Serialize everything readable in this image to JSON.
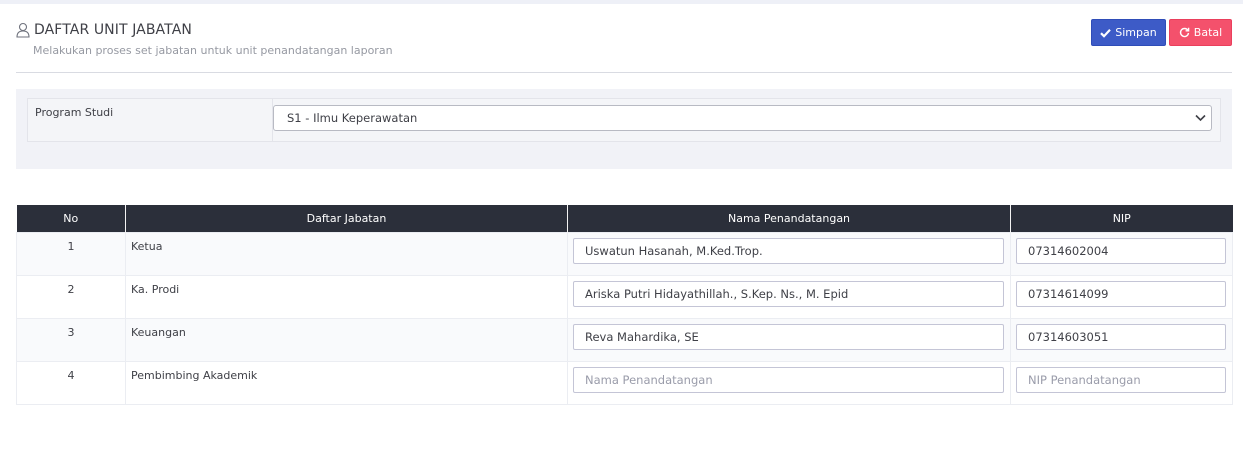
{
  "header": {
    "title": "DAFTAR UNIT JABATAN",
    "subtitle": "Melakukan proses set jabatan untuk unit penandatangan laporan",
    "icon": "user-icon"
  },
  "actions": {
    "save_label": "Simpan",
    "cancel_label": "Batal",
    "save_color": "#3d5bc7",
    "cancel_color": "#f4516c"
  },
  "filter": {
    "label": "Program Studi",
    "selected": "S1 - Ilmu Keperawatan"
  },
  "table": {
    "columns": [
      "No",
      "Daftar Jabatan",
      "Nama Penandatangan",
      "NIP"
    ],
    "rows": [
      {
        "no": "1",
        "jabatan": "Ketua",
        "nama": "Uswatun Hasanah, M.Ked.Trop.",
        "nip": "07314602004"
      },
      {
        "no": "2",
        "jabatan": "Ka. Prodi",
        "nama": "Ariska Putri Hidayathillah., S.Kep. Ns., M. Epid",
        "nip": "07314614099"
      },
      {
        "no": "3",
        "jabatan": "Keuangan",
        "nama": "Reva Mahardika, SE",
        "nip": "07314603051"
      },
      {
        "no": "4",
        "jabatan": "Pembimbing Akademik",
        "nama": "",
        "nip": ""
      }
    ],
    "placeholders": {
      "nama": "Nama Penandatangan",
      "nip": "NIP Penandatangan"
    }
  }
}
